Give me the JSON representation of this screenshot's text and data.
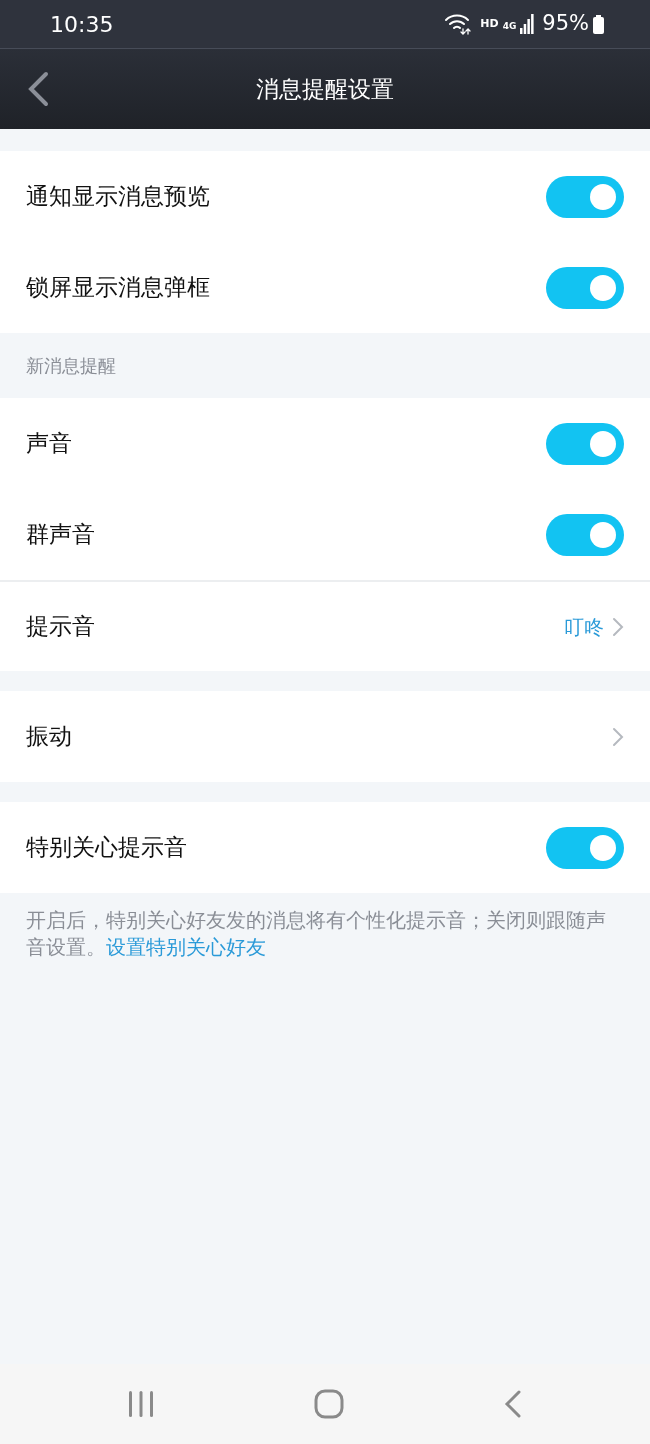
{
  "status_bar": {
    "time": "10:35",
    "hd": "HD",
    "network": "4G",
    "battery": "95%"
  },
  "header": {
    "title": "消息提醒设置"
  },
  "groups": [
    {
      "items": [
        {
          "kind": "toggle",
          "label": "通知显示消息预览",
          "on": true
        },
        {
          "kind": "toggle",
          "label": "锁屏显示消息弹框",
          "on": true
        }
      ]
    },
    {
      "heading": "新消息提醒",
      "items": [
        {
          "kind": "toggle",
          "label": "声音",
          "on": true
        },
        {
          "kind": "toggle",
          "label": "群声音",
          "on": true
        },
        {
          "kind": "link",
          "label": "提示音",
          "value": "叮咚"
        }
      ]
    },
    {
      "items": [
        {
          "kind": "link",
          "label": "振动"
        }
      ]
    },
    {
      "items": [
        {
          "kind": "toggle",
          "label": "特别关心提示音",
          "on": true
        }
      ]
    }
  ],
  "note": {
    "text": "开启后，特别关心好友发的消息将有个性化提示音；关闭则跟随声音设置。",
    "link": "设置特别关心好友"
  }
}
